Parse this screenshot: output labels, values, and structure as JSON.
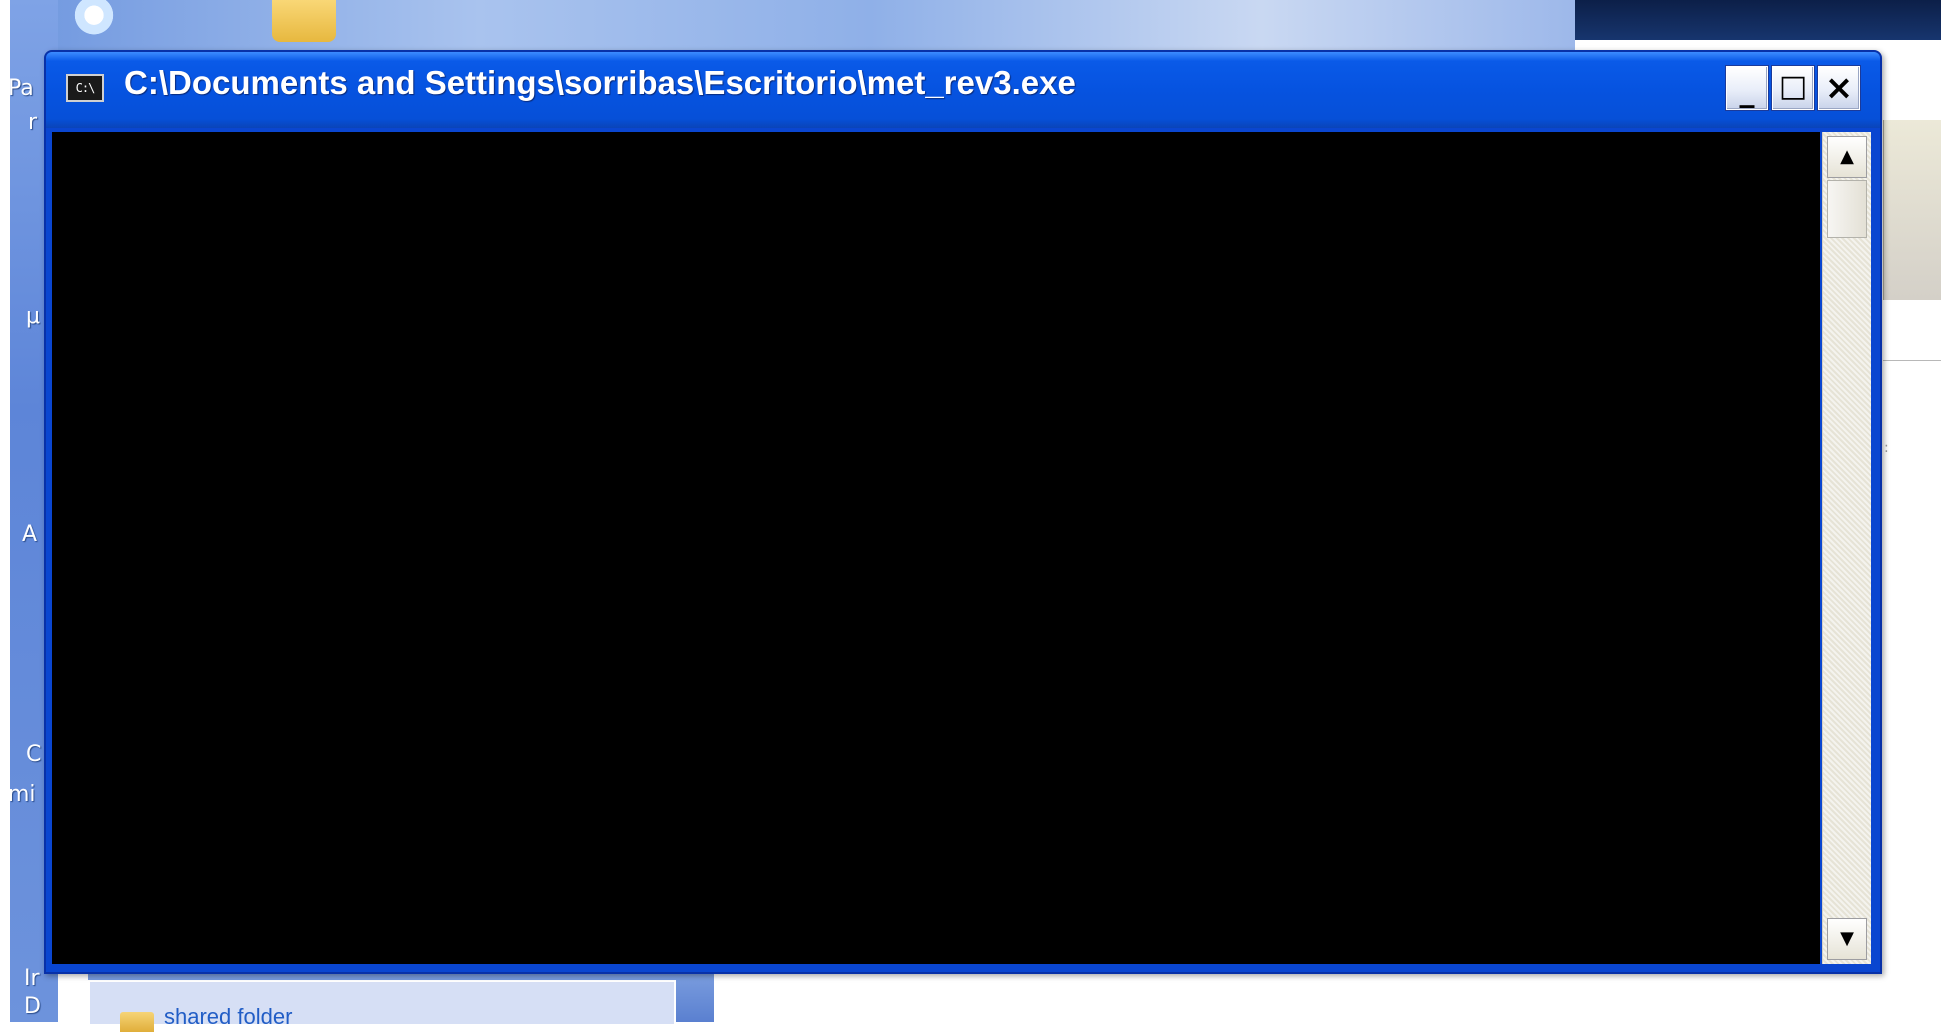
{
  "window": {
    "title": "C:\\Documents and Settings\\sorribas\\Escritorio\\met_rev3.exe",
    "icon_name": "console-app-icon",
    "icon_text": "C:\\",
    "controls": {
      "minimize": "_",
      "maximize": "□",
      "close": "×"
    },
    "titlebar_color": "#0653e0",
    "console_background": "#000000"
  },
  "scrollbar": {
    "up_arrow": "▲",
    "down_arrow": "▼",
    "position": 0
  },
  "desktop": {
    "left_edge_fragments": [
      "Pa",
      "r",
      "μ",
      "A",
      "C",
      "mi",
      "Ir",
      "D"
    ],
    "taskpane_item": "shared folder",
    "right_fragment": ":"
  }
}
